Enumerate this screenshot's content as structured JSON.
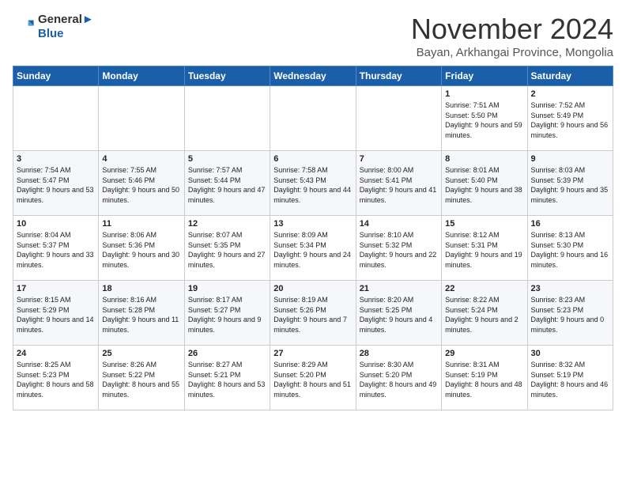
{
  "header": {
    "logo_line1": "General",
    "logo_line2": "Blue",
    "title": "November 2024",
    "subtitle": "Bayan, Arkhangai Province, Mongolia"
  },
  "weekdays": [
    "Sunday",
    "Monday",
    "Tuesday",
    "Wednesday",
    "Thursday",
    "Friday",
    "Saturday"
  ],
  "weeks": [
    [
      {
        "day": "",
        "info": ""
      },
      {
        "day": "",
        "info": ""
      },
      {
        "day": "",
        "info": ""
      },
      {
        "day": "",
        "info": ""
      },
      {
        "day": "",
        "info": ""
      },
      {
        "day": "1",
        "info": "Sunrise: 7:51 AM\nSunset: 5:50 PM\nDaylight: 9 hours and 59 minutes."
      },
      {
        "day": "2",
        "info": "Sunrise: 7:52 AM\nSunset: 5:49 PM\nDaylight: 9 hours and 56 minutes."
      }
    ],
    [
      {
        "day": "3",
        "info": "Sunrise: 7:54 AM\nSunset: 5:47 PM\nDaylight: 9 hours and 53 minutes."
      },
      {
        "day": "4",
        "info": "Sunrise: 7:55 AM\nSunset: 5:46 PM\nDaylight: 9 hours and 50 minutes."
      },
      {
        "day": "5",
        "info": "Sunrise: 7:57 AM\nSunset: 5:44 PM\nDaylight: 9 hours and 47 minutes."
      },
      {
        "day": "6",
        "info": "Sunrise: 7:58 AM\nSunset: 5:43 PM\nDaylight: 9 hours and 44 minutes."
      },
      {
        "day": "7",
        "info": "Sunrise: 8:00 AM\nSunset: 5:41 PM\nDaylight: 9 hours and 41 minutes."
      },
      {
        "day": "8",
        "info": "Sunrise: 8:01 AM\nSunset: 5:40 PM\nDaylight: 9 hours and 38 minutes."
      },
      {
        "day": "9",
        "info": "Sunrise: 8:03 AM\nSunset: 5:39 PM\nDaylight: 9 hours and 35 minutes."
      }
    ],
    [
      {
        "day": "10",
        "info": "Sunrise: 8:04 AM\nSunset: 5:37 PM\nDaylight: 9 hours and 33 minutes."
      },
      {
        "day": "11",
        "info": "Sunrise: 8:06 AM\nSunset: 5:36 PM\nDaylight: 9 hours and 30 minutes."
      },
      {
        "day": "12",
        "info": "Sunrise: 8:07 AM\nSunset: 5:35 PM\nDaylight: 9 hours and 27 minutes."
      },
      {
        "day": "13",
        "info": "Sunrise: 8:09 AM\nSunset: 5:34 PM\nDaylight: 9 hours and 24 minutes."
      },
      {
        "day": "14",
        "info": "Sunrise: 8:10 AM\nSunset: 5:32 PM\nDaylight: 9 hours and 22 minutes."
      },
      {
        "day": "15",
        "info": "Sunrise: 8:12 AM\nSunset: 5:31 PM\nDaylight: 9 hours and 19 minutes."
      },
      {
        "day": "16",
        "info": "Sunrise: 8:13 AM\nSunset: 5:30 PM\nDaylight: 9 hours and 16 minutes."
      }
    ],
    [
      {
        "day": "17",
        "info": "Sunrise: 8:15 AM\nSunset: 5:29 PM\nDaylight: 9 hours and 14 minutes."
      },
      {
        "day": "18",
        "info": "Sunrise: 8:16 AM\nSunset: 5:28 PM\nDaylight: 9 hours and 11 minutes."
      },
      {
        "day": "19",
        "info": "Sunrise: 8:17 AM\nSunset: 5:27 PM\nDaylight: 9 hours and 9 minutes."
      },
      {
        "day": "20",
        "info": "Sunrise: 8:19 AM\nSunset: 5:26 PM\nDaylight: 9 hours and 7 minutes."
      },
      {
        "day": "21",
        "info": "Sunrise: 8:20 AM\nSunset: 5:25 PM\nDaylight: 9 hours and 4 minutes."
      },
      {
        "day": "22",
        "info": "Sunrise: 8:22 AM\nSunset: 5:24 PM\nDaylight: 9 hours and 2 minutes."
      },
      {
        "day": "23",
        "info": "Sunrise: 8:23 AM\nSunset: 5:23 PM\nDaylight: 9 hours and 0 minutes."
      }
    ],
    [
      {
        "day": "24",
        "info": "Sunrise: 8:25 AM\nSunset: 5:23 PM\nDaylight: 8 hours and 58 minutes."
      },
      {
        "day": "25",
        "info": "Sunrise: 8:26 AM\nSunset: 5:22 PM\nDaylight: 8 hours and 55 minutes."
      },
      {
        "day": "26",
        "info": "Sunrise: 8:27 AM\nSunset: 5:21 PM\nDaylight: 8 hours and 53 minutes."
      },
      {
        "day": "27",
        "info": "Sunrise: 8:29 AM\nSunset: 5:20 PM\nDaylight: 8 hours and 51 minutes."
      },
      {
        "day": "28",
        "info": "Sunrise: 8:30 AM\nSunset: 5:20 PM\nDaylight: 8 hours and 49 minutes."
      },
      {
        "day": "29",
        "info": "Sunrise: 8:31 AM\nSunset: 5:19 PM\nDaylight: 8 hours and 48 minutes."
      },
      {
        "day": "30",
        "info": "Sunrise: 8:32 AM\nSunset: 5:19 PM\nDaylight: 8 hours and 46 minutes."
      }
    ]
  ]
}
